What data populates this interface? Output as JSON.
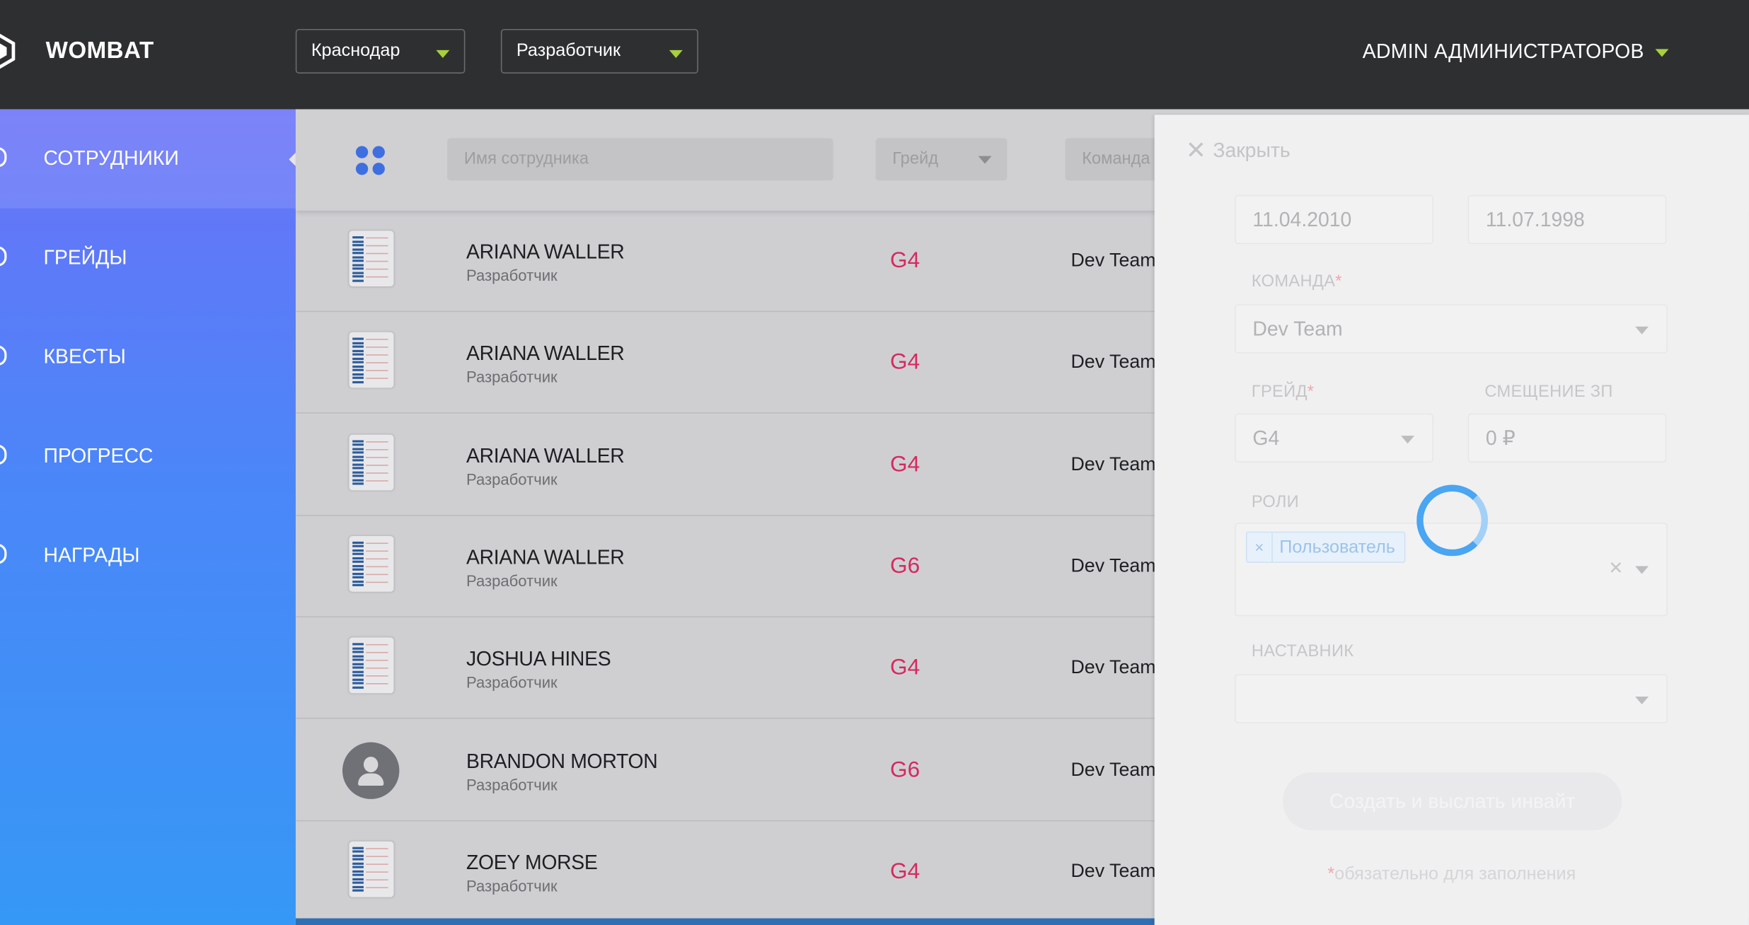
{
  "app": {
    "brand": "WOMBAT"
  },
  "header": {
    "city_select": "Краснодар",
    "role_select": "Разработчик",
    "user_menu": "ADMIN АДМИНИСТРАТОРОВ"
  },
  "sidebar": {
    "items": [
      {
        "label": "СОТРУДНИКИ",
        "active": true
      },
      {
        "label": "ГРЕЙДЫ"
      },
      {
        "label": "КВЕСТЫ"
      },
      {
        "label": "ПРОГРЕСС"
      },
      {
        "label": "НАГРАДЫ"
      }
    ]
  },
  "filters": {
    "name_placeholder": "Имя сотрудника",
    "grade_placeholder": "Грейд",
    "team_placeholder": "Команда"
  },
  "employees": [
    {
      "name": "ARIANA WALLER",
      "position": "Разработчик",
      "grade": "G4",
      "team": "Dev Team",
      "avatar": "document"
    },
    {
      "name": "ARIANA WALLER",
      "position": "Разработчик",
      "grade": "G4",
      "team": "Dev Team",
      "avatar": "document"
    },
    {
      "name": "ARIANA WALLER",
      "position": "Разработчик",
      "grade": "G4",
      "team": "Dev Team",
      "avatar": "document"
    },
    {
      "name": "ARIANA WALLER",
      "position": "Разработчик",
      "grade": "G6",
      "team": "Dev Team",
      "avatar": "document"
    },
    {
      "name": "JOSHUA HINES",
      "position": "Разработчик",
      "grade": "G4",
      "team": "Dev Team",
      "avatar": "document"
    },
    {
      "name": "BRANDON MORTON",
      "position": "Разработчик",
      "grade": "G6",
      "team": "Dev Team",
      "avatar": "user-placeholder"
    },
    {
      "name": "ZOEY MORSE",
      "position": "Разработчик",
      "grade": "G4",
      "team": "Dev Team",
      "avatar": "document"
    }
  ],
  "drawer": {
    "close_label": "Закрыть",
    "date1": "11.04.2010",
    "date2": "11.07.1998",
    "team_label": "КОМАНДА",
    "team_value": "Dev Team",
    "grade_label": "ГРЕЙД",
    "grade_value": "G4",
    "salary_label": "СМЕЩЕНИЕ ЗП",
    "salary_value": "0 ₽",
    "roles_label": "РОЛИ",
    "role_chip": "Пользователь",
    "mentor_label": "НАСТАВНИК",
    "mentor_value": "",
    "submit_label": "Создать и выслать инвайт",
    "required_mark": "*",
    "required_note": "обязательно для заполнения"
  },
  "colors": {
    "header_bg": "#2e2f31",
    "accent_caret": "#a6d13c",
    "grade_text": "#d6295f",
    "sidebar_gradient_top": "#6a72f8",
    "sidebar_gradient_bottom": "#3698f6",
    "spinner": "#4aa5f2"
  }
}
